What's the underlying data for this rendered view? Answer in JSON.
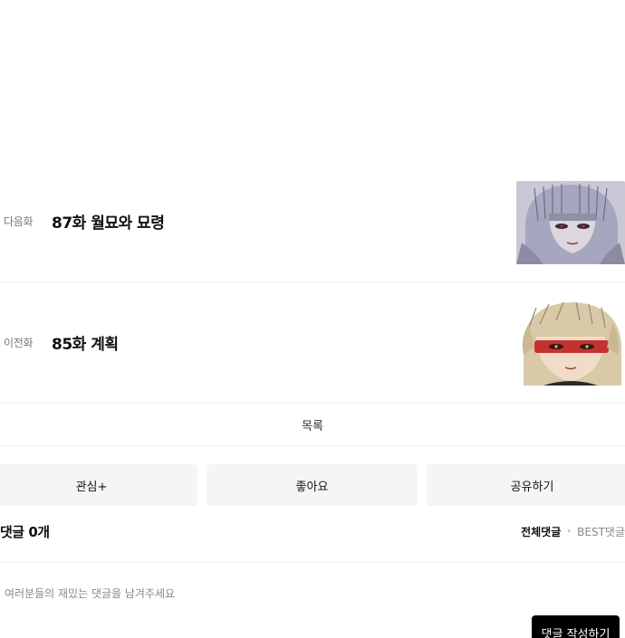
{
  "episodes": {
    "next": {
      "kind": "다음화",
      "title": "87화 월묘와 묘령",
      "thumbnail_icon": "next-episode-thumbnail"
    },
    "prev": {
      "kind": "이전화",
      "title": "85화 계획",
      "thumbnail_icon": "prev-episode-thumbnail"
    }
  },
  "list_link": "목록",
  "actions": {
    "subscribe": "관심+",
    "like": "좋아요",
    "share": "공유하기"
  },
  "comments": {
    "count_label": "댓글 0개",
    "sort_all": "전체댓글",
    "sort_sep": "•",
    "sort_best": "BEST댓글",
    "placeholder": "여러분들의 재밌는 댓글을 남겨주세요",
    "write_button": "댓글 작성하기"
  },
  "colors": {
    "background": "#ffffff",
    "button_bg": "#f5f5f5",
    "divider": "#efefef",
    "write_button_bg": "#000000"
  }
}
